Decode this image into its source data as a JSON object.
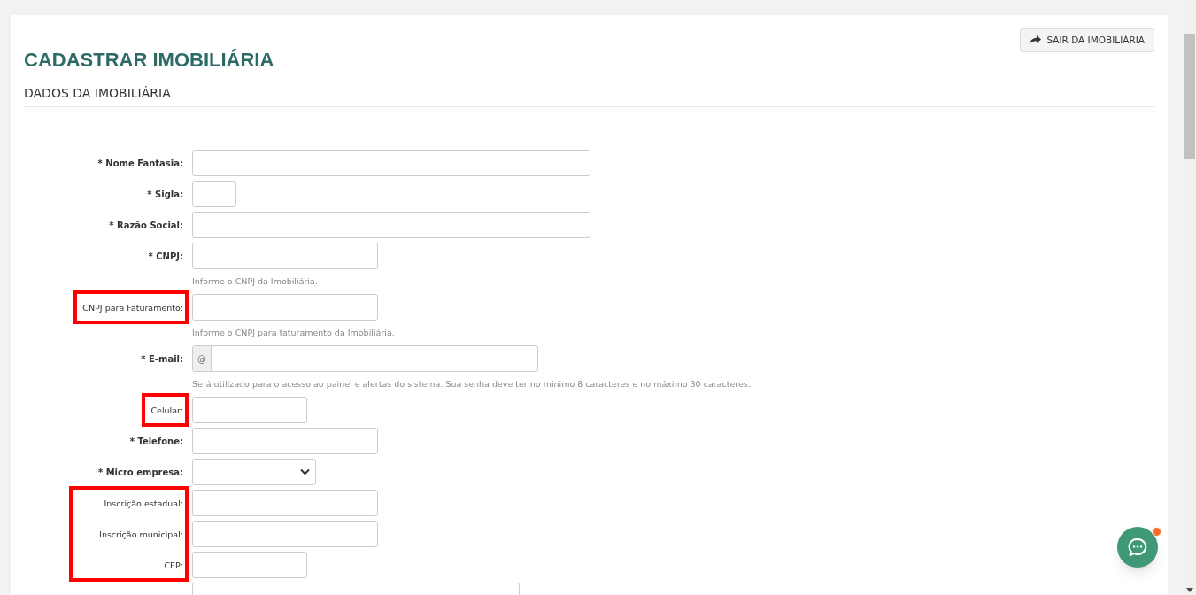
{
  "exit_button": {
    "label": "SAIR DA IMOBILIÁRIA"
  },
  "title": "CADASTRAR IMOBILIÁRIA",
  "section": "DADOS DA IMOBILIÁRIA",
  "fields": [
    {
      "label": "* Nome Fantasia:",
      "required": true,
      "kind": "text",
      "highlighted": false
    },
    {
      "label": "* Sigla:",
      "required": true,
      "kind": "text",
      "highlighted": false
    },
    {
      "label": "* Razão Social:",
      "required": true,
      "kind": "text",
      "highlighted": false
    },
    {
      "label": "* CNPJ:",
      "required": true,
      "kind": "text",
      "highlighted": false,
      "help": "Informe o CNPJ da Imobiliária."
    },
    {
      "label": "CNPJ para Faturamento:",
      "required": false,
      "kind": "text",
      "highlighted": true,
      "help": "Informe o CNPJ para faturamento da Imobiliária."
    },
    {
      "label": "* E-mail:",
      "required": true,
      "kind": "email",
      "addon": "@",
      "highlighted": false,
      "help": "Será utilizado para o acesso ao painel e alertas do sistema. Sua senha deve ter no minimo 8 caracteres e no máximo 30 caracteres."
    },
    {
      "label": "Celular:",
      "required": false,
      "kind": "text",
      "highlighted": true
    },
    {
      "label": "* Telefone:",
      "required": true,
      "kind": "text",
      "highlighted": false
    },
    {
      "label": "* Micro empresa:",
      "required": true,
      "kind": "select",
      "highlighted": false
    },
    {
      "label": "Inscrição estadual:",
      "required": false,
      "kind": "text",
      "highlighted": true
    },
    {
      "label": "Inscrição municipal:",
      "required": false,
      "kind": "text",
      "highlighted": true
    },
    {
      "label": "CEP:",
      "required": false,
      "kind": "text",
      "highlighted": true
    },
    {
      "kind": "text"
    }
  ]
}
